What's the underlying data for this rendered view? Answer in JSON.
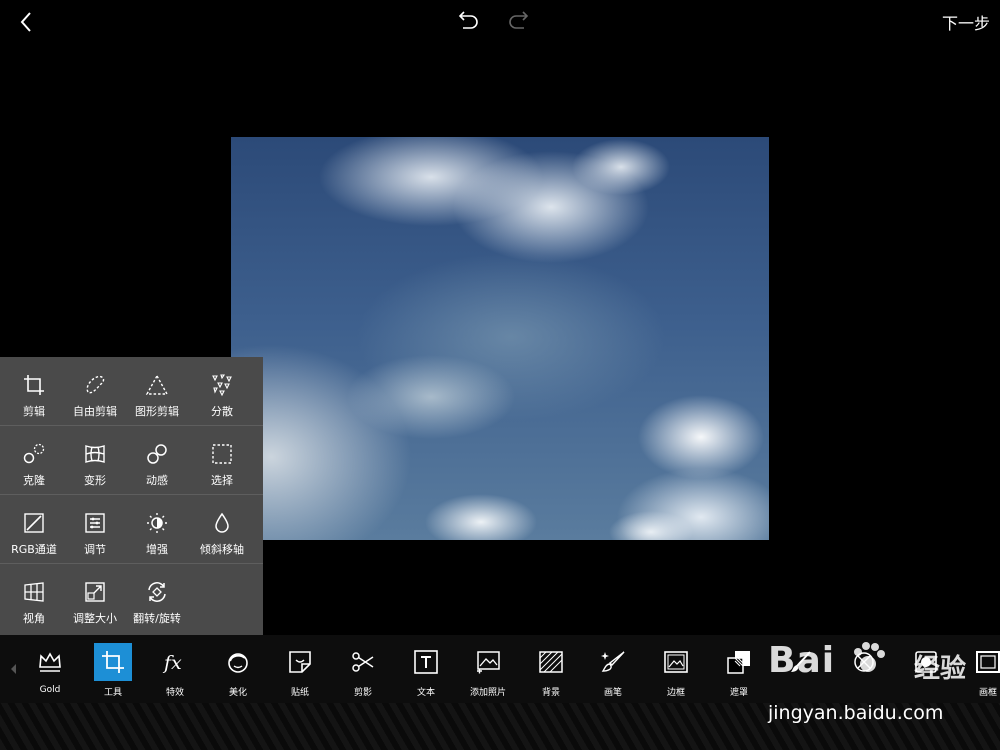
{
  "topbar": {
    "next_label": "下一步"
  },
  "panel": {
    "rows": [
      [
        {
          "label": "剪辑",
          "icon": "crop-icon"
        },
        {
          "label": "自由剪辑",
          "icon": "freecrop-icon"
        },
        {
          "label": "图形剪辑",
          "icon": "shapecrop-icon"
        },
        {
          "label": "分散",
          "icon": "disperse-icon"
        }
      ],
      [
        {
          "label": "克隆",
          "icon": "clone-icon"
        },
        {
          "label": "变形",
          "icon": "warp-icon"
        },
        {
          "label": "动感",
          "icon": "motion-icon"
        },
        {
          "label": "选择",
          "icon": "select-icon"
        }
      ],
      [
        {
          "label": "RGB通道",
          "icon": "curves-icon"
        },
        {
          "label": "调节",
          "icon": "adjust-icon"
        },
        {
          "label": "增强",
          "icon": "enhance-icon"
        },
        {
          "label": "倾斜移轴",
          "icon": "tiltshift-icon"
        }
      ],
      [
        {
          "label": "视角",
          "icon": "perspective-icon"
        },
        {
          "label": "调整大小",
          "icon": "resize-icon"
        },
        {
          "label": "翻转/旋转",
          "icon": "fliprotate-icon"
        }
      ]
    ]
  },
  "bottombar": {
    "items": [
      {
        "label": "Gold",
        "icon": "crown-icon"
      },
      {
        "label": "工具",
        "icon": "crop-icon",
        "active": true
      },
      {
        "label": "特效",
        "icon": "fx-icon"
      },
      {
        "label": "美化",
        "icon": "beautify-icon"
      },
      {
        "label": "贴纸",
        "icon": "sticker-icon"
      },
      {
        "label": "剪影",
        "icon": "cutout-icon"
      },
      {
        "label": "文本",
        "icon": "text-icon"
      },
      {
        "label": "添加照片",
        "icon": "add-photo-icon"
      },
      {
        "label": "背景",
        "icon": "background-icon"
      },
      {
        "label": "画笔",
        "icon": "brush-icon"
      },
      {
        "label": "边框",
        "icon": "frame-icon"
      },
      {
        "label": "遮罩",
        "icon": "mask-icon"
      },
      {
        "label": "",
        "icon": "draw-icon"
      },
      {
        "label": "",
        "icon": "lens-icon"
      },
      {
        "label": "",
        "icon": "square-fit-icon"
      },
      {
        "label": "画框",
        "icon": "picture-frame-icon"
      }
    ]
  },
  "watermark": {
    "logo": "Bai",
    "cn": "经验",
    "url": "jingyan.baidu.com"
  },
  "colors": {
    "accent": "#1d8fd6",
    "panel": "#4a4a4a"
  }
}
